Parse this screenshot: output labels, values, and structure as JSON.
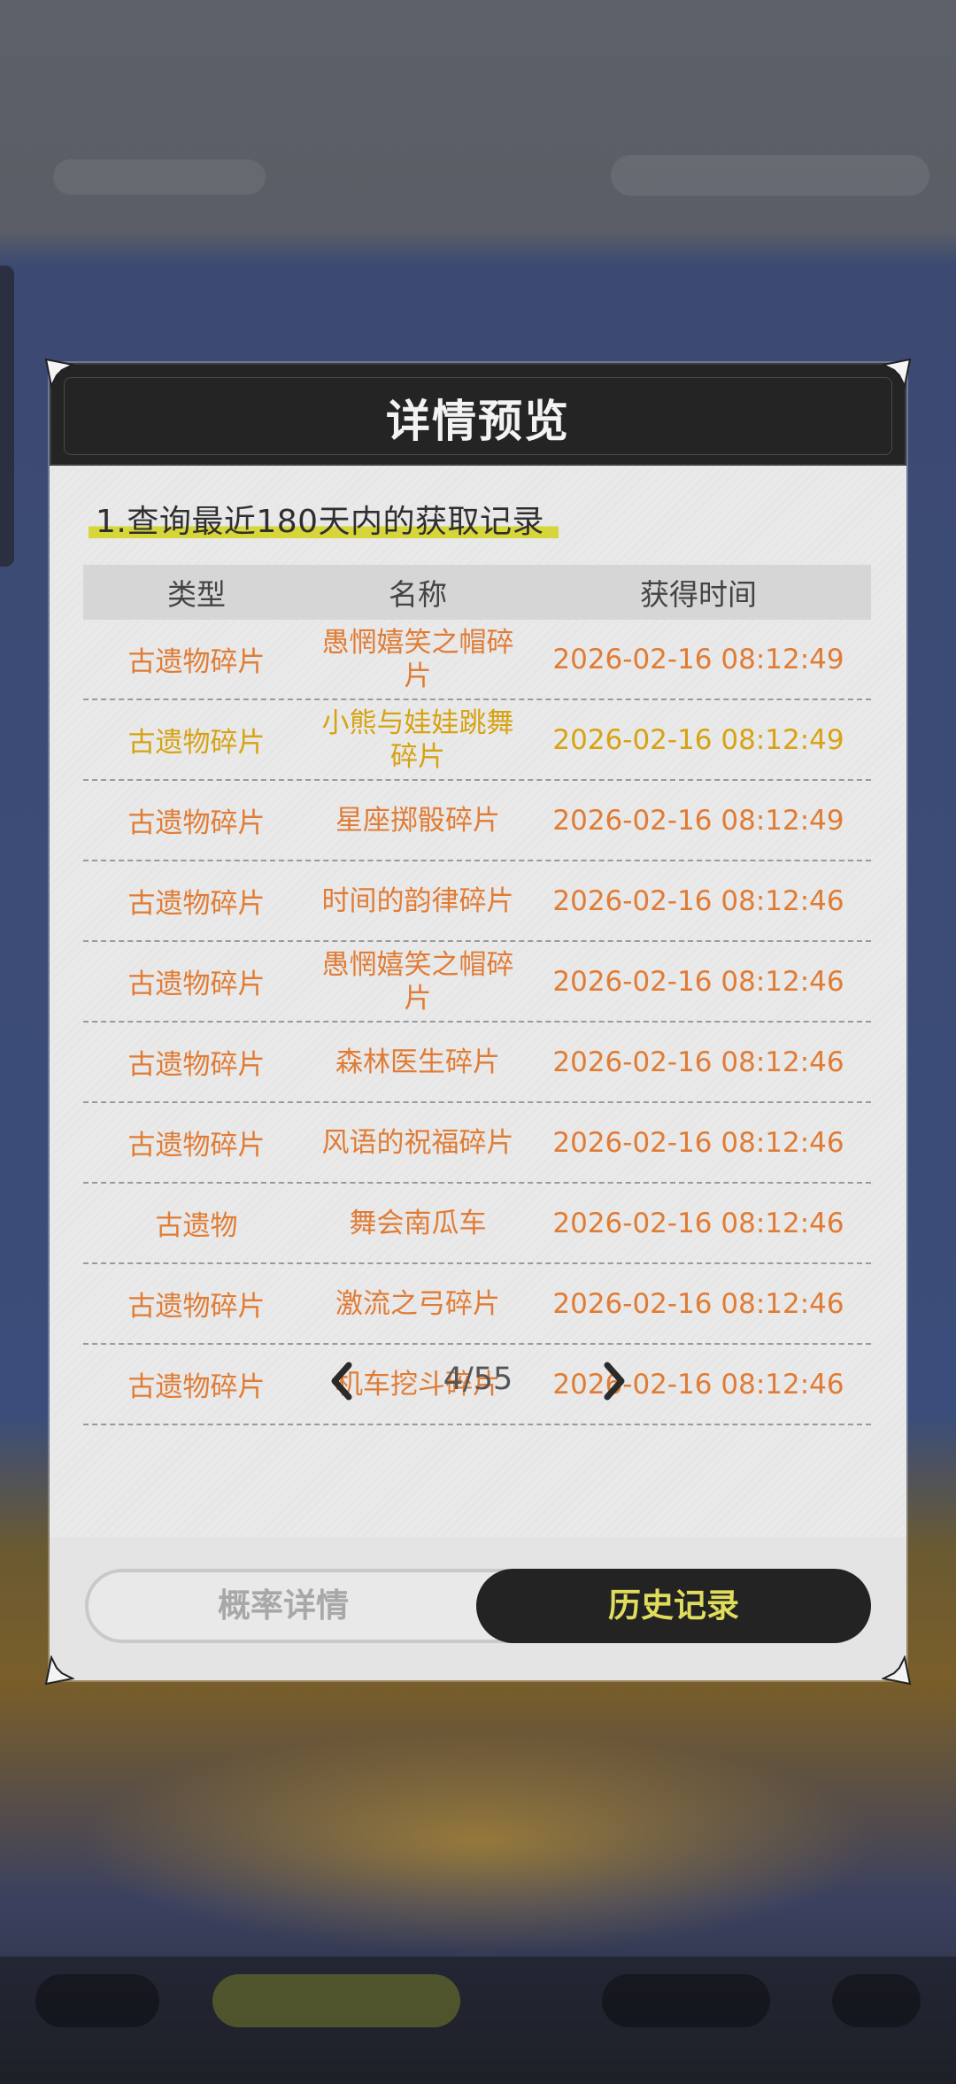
{
  "dialog": {
    "title": "详情预览",
    "section_title": "1.查询最近180天内的获取记录"
  },
  "table": {
    "headers": [
      "类型",
      "名称",
      "获得时间"
    ],
    "rows": [
      {
        "type": "古遗物碎片",
        "name": "愚惘嬉笑之帽碎片",
        "time": "2026-02-16 08:12:49",
        "color": "#e07c35"
      },
      {
        "type": "古遗物碎片",
        "name": "小熊与娃娃跳舞碎片",
        "time": "2026-02-16 08:12:49",
        "color": "#d7a313"
      },
      {
        "type": "古遗物碎片",
        "name": "星座掷骰碎片",
        "time": "2026-02-16 08:12:49",
        "color": "#e07c35"
      },
      {
        "type": "古遗物碎片",
        "name": "时间的韵律碎片",
        "time": "2026-02-16 08:12:46",
        "color": "#e07c35"
      },
      {
        "type": "古遗物碎片",
        "name": "愚惘嬉笑之帽碎片",
        "time": "2026-02-16 08:12:46",
        "color": "#e07c35"
      },
      {
        "type": "古遗物碎片",
        "name": "森林医生碎片",
        "time": "2026-02-16 08:12:46",
        "color": "#e07c35"
      },
      {
        "type": "古遗物碎片",
        "name": "风语的祝福碎片",
        "time": "2026-02-16 08:12:46",
        "color": "#e07c35"
      },
      {
        "type": "古遗物",
        "name": "舞会南瓜车",
        "time": "2026-02-16 08:12:46",
        "color": "#e07c35"
      },
      {
        "type": "古遗物碎片",
        "name": "激流之弓碎片",
        "time": "2026-02-16 08:12:46",
        "color": "#e07c35"
      },
      {
        "type": "古遗物碎片",
        "name": "机车挖斗碎片",
        "time": "2026-02-16 08:12:46",
        "color": "#e07c35"
      }
    ]
  },
  "pager": {
    "page": "4/55",
    "prev_icon": "chevron-left-icon",
    "next_icon": "chevron-right-icon"
  },
  "tabs": {
    "probability_label": "概率详情",
    "history_label": "历史记录",
    "active": "history"
  },
  "colors": {
    "accent_yellow": "#e0dc5c",
    "highlight": "#d6d63a",
    "orange_text": "#e07c35",
    "gold_text": "#d7a313",
    "header_bg": "#242424"
  }
}
